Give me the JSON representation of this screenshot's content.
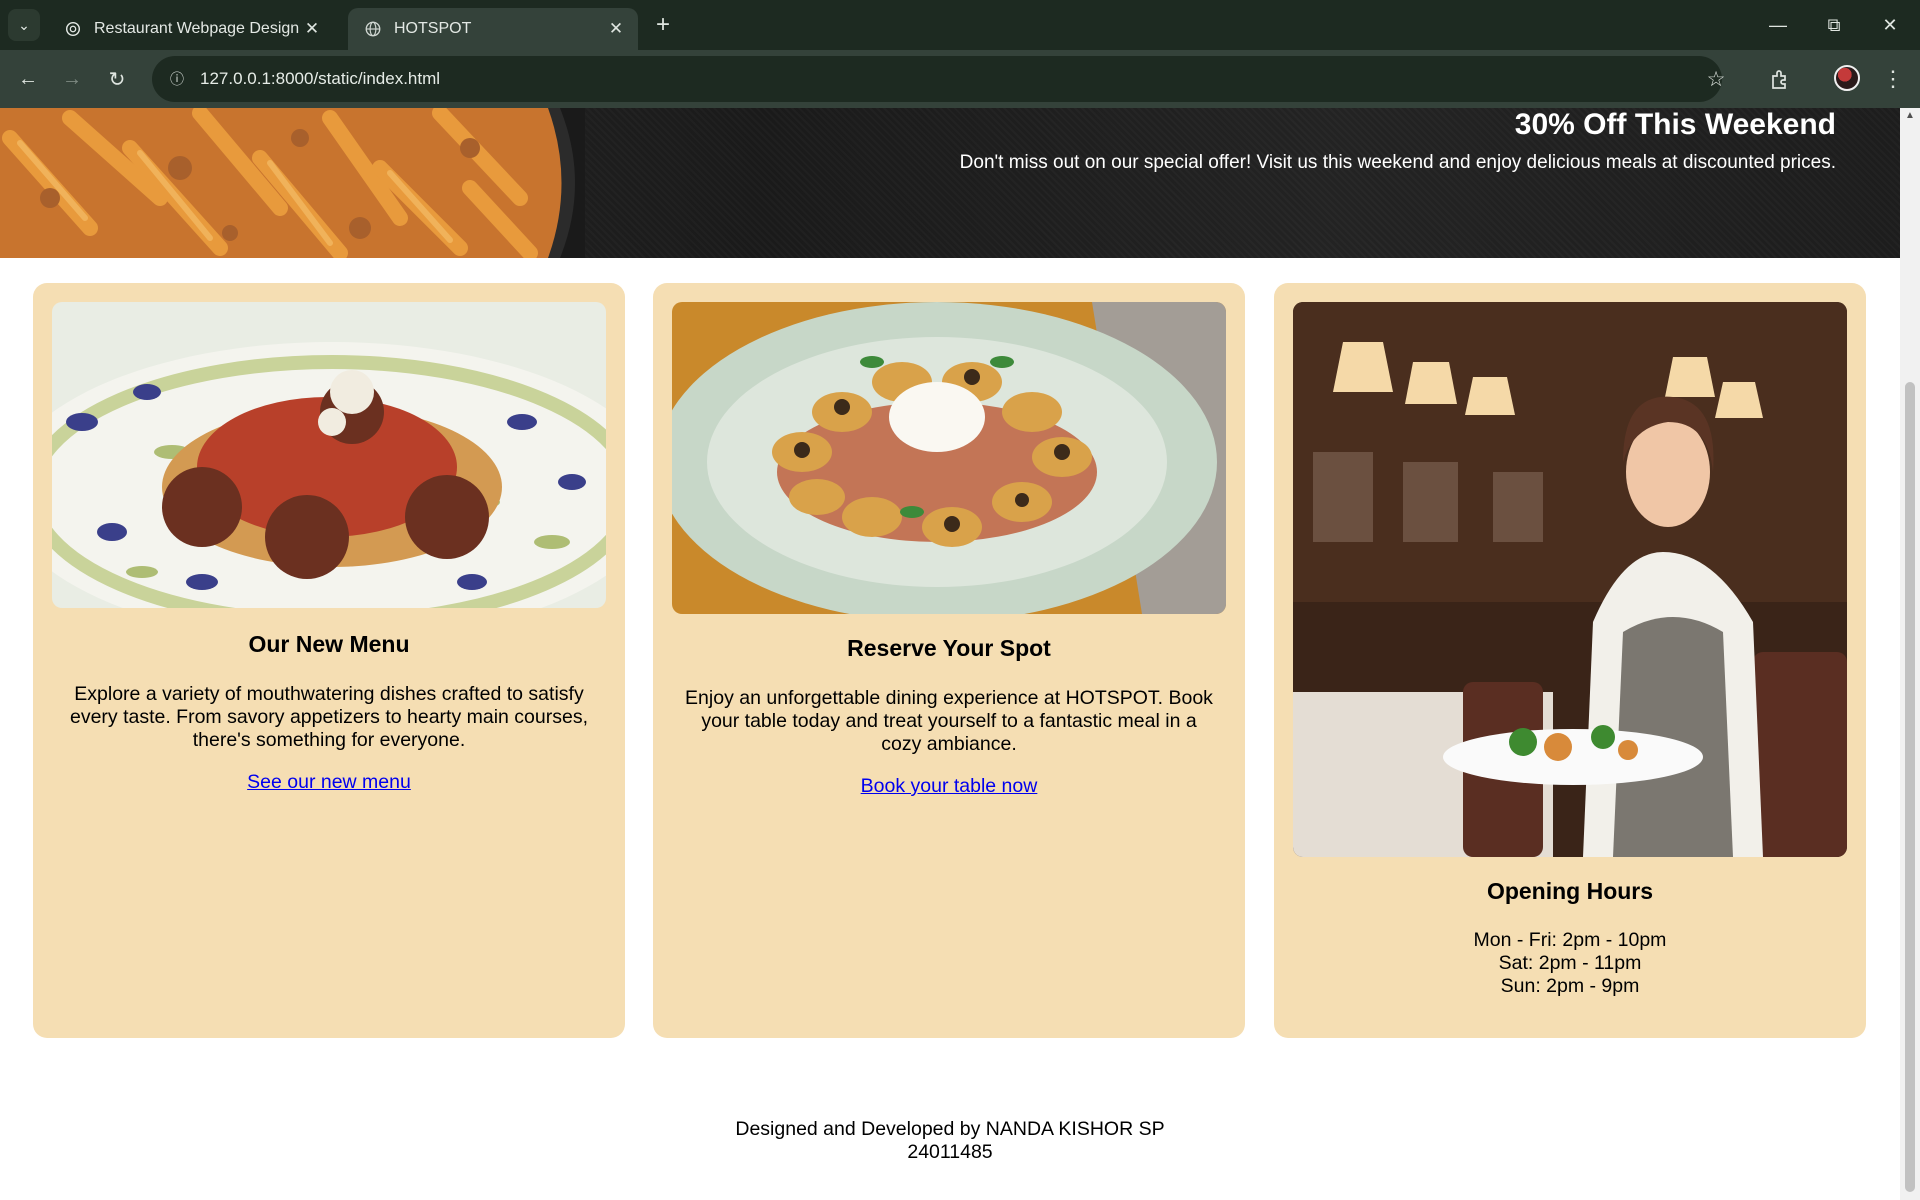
{
  "browser": {
    "tabs": [
      {
        "title": "Restaurant Webpage Design",
        "active": false
      },
      {
        "title": "HOTSPOT",
        "active": true
      }
    ],
    "url": "127.0.0.1:8000/static/index.html"
  },
  "banner": {
    "title": "30% Off This Weekend",
    "text": "Don't miss out on our special offer! Visit us this weekend and enjoy delicious meals at discounted prices."
  },
  "cards": [
    {
      "title": "Our New Menu",
      "text": "Explore a variety of mouthwatering dishes crafted to satisfy every taste. From savory appetizers to hearty main courses, there's something for everyone.",
      "link": "See our new menu"
    },
    {
      "title": "Reserve Your Spot",
      "text": "Enjoy an unforgettable dining experience at HOTSPOT. Book your table today and treat yourself to a fantastic meal in a cozy ambiance.",
      "link": "Book your table now"
    },
    {
      "title": "Opening Hours",
      "hours": [
        "Mon - Fri: 2pm - 10pm",
        "Sat: 2pm - 11pm",
        "Sun: 2pm - 9pm"
      ]
    }
  ],
  "footer": {
    "credit": "Designed and Developed by NANDA KISHOR SP",
    "id": "24011485"
  },
  "colors": {
    "card_bg": "#f5deb3",
    "link": "#0000ee",
    "banner_bg": "#1e1e1e",
    "chrome_dark": "#1d2a21",
    "chrome_toolbar": "#34423a"
  },
  "icons": [
    "tab-search-icon",
    "chatgpt-favicon-icon",
    "globe-favicon-icon",
    "close-icon",
    "plus-icon",
    "minimize-icon",
    "restore-icon",
    "back-icon",
    "forward-icon",
    "reload-icon",
    "site-info-icon",
    "star-icon",
    "extensions-icon",
    "kebab-menu-icon"
  ]
}
